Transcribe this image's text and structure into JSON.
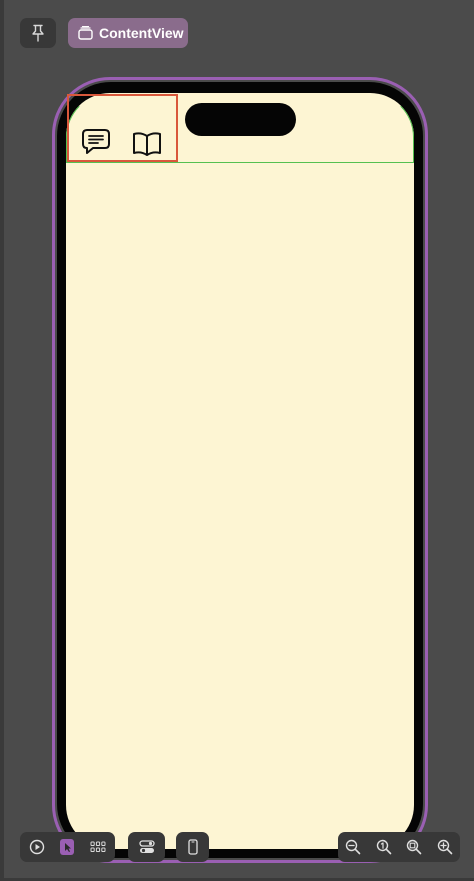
{
  "toolbar": {
    "pin_icon": "pin-icon",
    "breadcrumb_icon": "view-stack-icon",
    "breadcrumb_label": "ContentView"
  },
  "device": {
    "outline_color": "#9a5fb3",
    "screen_background": "#fdf5d3",
    "selection_color": "#55c050",
    "highlight_color": "#d9583b",
    "screen_icons": [
      "chat-bubble-icon",
      "book-icon"
    ]
  },
  "bottom_toolbar": {
    "mode_buttons": [
      "live-preview-icon",
      "selectable-mode-icon",
      "variants-grid-icon"
    ],
    "selected_mode": "selectable-mode-icon",
    "settings_button": "device-settings-icon",
    "device_button": "device-icon",
    "zoom_buttons": [
      "zoom-out-icon",
      "zoom-actual-size-icon",
      "zoom-to-fit-icon",
      "zoom-in-icon"
    ]
  },
  "colors": {
    "background": "#4b4b4b",
    "button_background": "#383838",
    "breadcrumb_background": "#8a6c8c"
  }
}
